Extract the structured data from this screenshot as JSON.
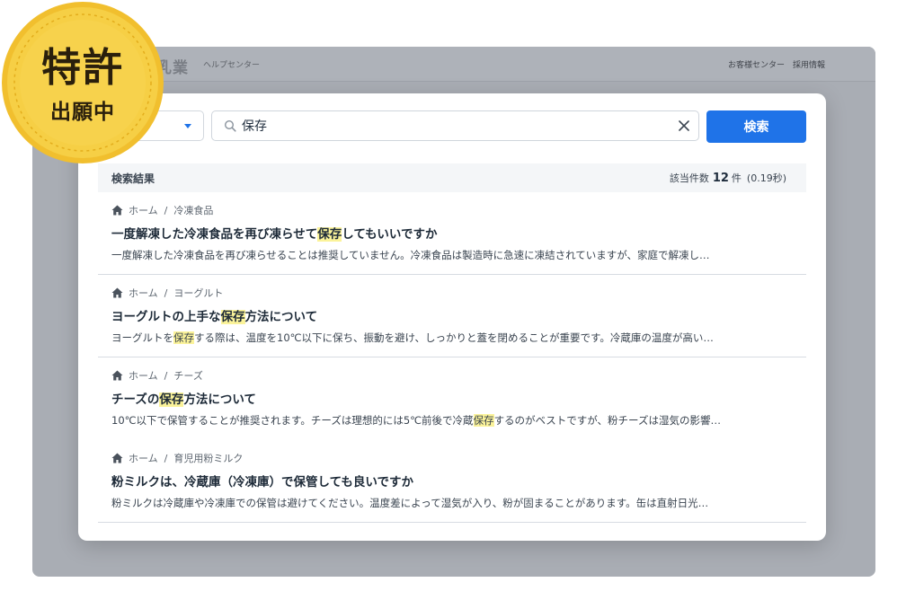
{
  "site": {
    "logo": "乳業",
    "help_label": "ヘルプセンター",
    "links": [
      "お客様センター",
      "採用情報"
    ]
  },
  "badge": {
    "main": "特許",
    "sub": "出願中",
    "color": "#f3c63a"
  },
  "search": {
    "value": "保存",
    "button_label": "検索"
  },
  "results": {
    "heading": "検索結果",
    "count_label": "該当件数",
    "count": "12",
    "unit": "件",
    "time": "(0.19秒)",
    "items": [
      {
        "crumb_home": "ホーム",
        "crumb_category": "冷凍食品",
        "title_pre": "一度解凍した冷凍食品を再び凍らせて",
        "title_hl": "保存",
        "title_post": "してもいいですか",
        "snippet_pre": "一度解凍した冷凍食品を再び凍らせることは推奨していません。冷凍食品は製造時に急速に凍結されていますが、家庭で解凍し…",
        "snippet_hl": "",
        "snippet_post": ""
      },
      {
        "crumb_home": "ホーム",
        "crumb_category": "ヨーグルト",
        "title_pre": "ヨーグルトの上手な",
        "title_hl": "保存",
        "title_post": "方法について",
        "snippet_pre": "ヨーグルトを",
        "snippet_hl": "保存",
        "snippet_post": "する際は、温度を10℃以下に保ち、振動を避け、しっかりと蓋を閉めることが重要です。冷蔵庫の温度が高い…"
      },
      {
        "crumb_home": "ホーム",
        "crumb_category": "チーズ",
        "title_pre": "チーズの",
        "title_hl": "保存",
        "title_post": "方法について",
        "snippet_pre": "10℃以下で保管することが推奨されます。チーズは理想的には5℃前後で冷蔵",
        "snippet_hl": "保存",
        "snippet_post": "するのがベストですが、粉チーズは湿気の影響…"
      },
      {
        "crumb_home": "ホーム",
        "crumb_category": "育児用粉ミルク",
        "title_pre": "粉ミルクは、冷蔵庫（冷凍庫）で保管しても良いですか",
        "title_hl": "",
        "title_post": "",
        "snippet_pre": "粉ミルクは冷蔵庫や冷凍庫での保管は避けてください。温度差によって湿気が入り、粉が固まることがあります。缶は直射日光…",
        "snippet_hl": "",
        "snippet_post": ""
      }
    ]
  }
}
